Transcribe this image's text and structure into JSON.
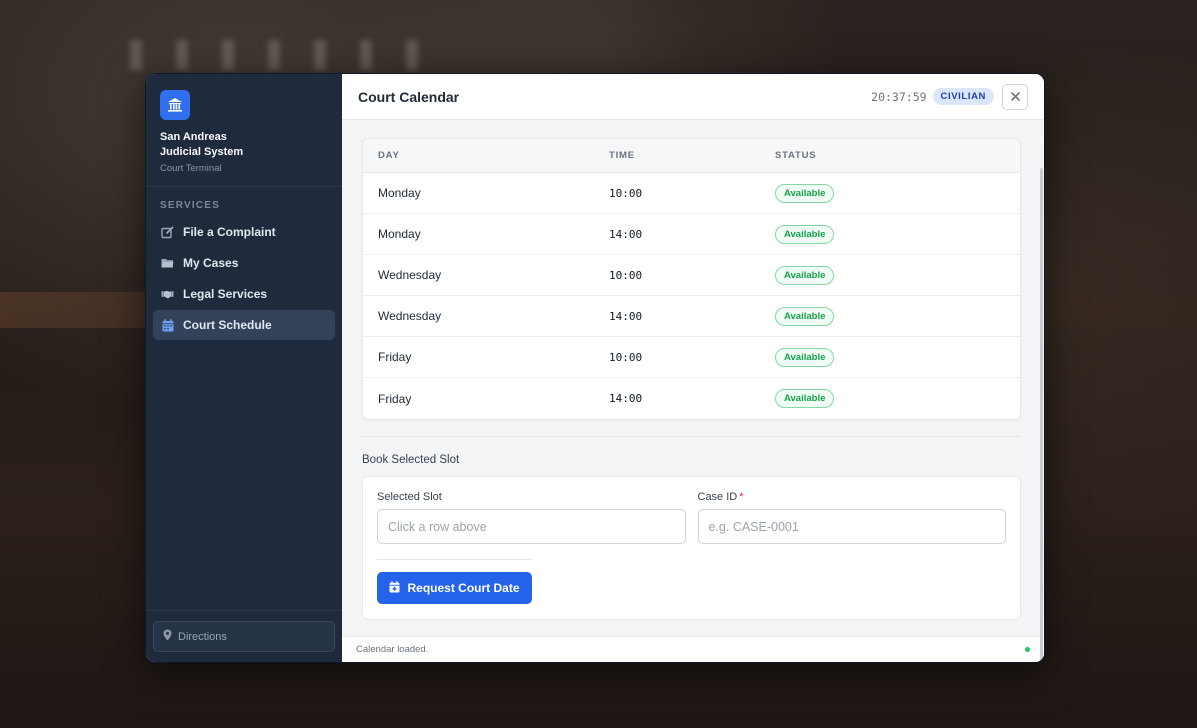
{
  "brand": {
    "title_line1": "San Andreas",
    "title_line2": "Judicial System",
    "subtitle": "Court Terminal",
    "logo_icon": "courthouse-icon"
  },
  "sidebar": {
    "section_label": "SERVICES",
    "items": [
      {
        "label": "File a Complaint",
        "icon": "edit-icon",
        "active": false
      },
      {
        "label": "My Cases",
        "icon": "folder-icon",
        "active": false
      },
      {
        "label": "Legal Services",
        "icon": "handshake-icon",
        "active": false
      },
      {
        "label": "Court Schedule",
        "icon": "calendar-icon",
        "active": true
      }
    ],
    "footer_button": {
      "label": "Directions",
      "icon": "map-pin-icon"
    }
  },
  "header": {
    "title": "Court Calendar",
    "clock": "20:37:59",
    "role_badge": "CIVILIAN",
    "close_icon": "close-icon"
  },
  "schedule": {
    "columns": [
      "DAY",
      "TIME",
      "STATUS"
    ],
    "rows": [
      {
        "day": "Monday",
        "time": "10:00",
        "status": "Available"
      },
      {
        "day": "Monday",
        "time": "14:00",
        "status": "Available"
      },
      {
        "day": "Wednesday",
        "time": "10:00",
        "status": "Available"
      },
      {
        "day": "Wednesday",
        "time": "14:00",
        "status": "Available"
      },
      {
        "day": "Friday",
        "time": "10:00",
        "status": "Available"
      },
      {
        "day": "Friday",
        "time": "14:00",
        "status": "Available"
      }
    ]
  },
  "booking": {
    "title": "Book Selected Slot",
    "selected_slot_label": "Selected Slot",
    "selected_slot_placeholder": "Click a row above",
    "case_id_label": "Case ID",
    "case_id_required": "*",
    "case_id_placeholder": "e.g. CASE-0001",
    "submit_label": "Request Court Date"
  },
  "statusbar": {
    "message": "Calendar loaded."
  },
  "colors": {
    "accent": "#2563eb",
    "sidebar_bg": "#1f2a3c",
    "status_available": "#16a34a"
  }
}
